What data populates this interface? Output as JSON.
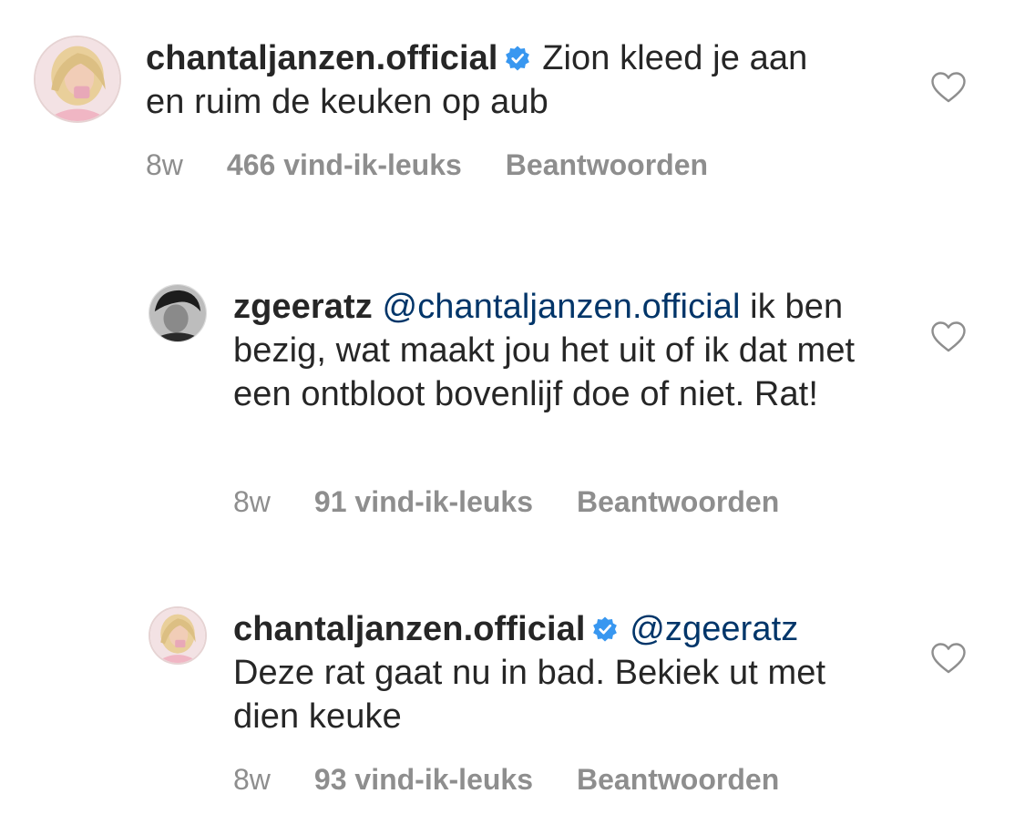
{
  "comments": [
    {
      "username": "chantaljanzen.official",
      "verified": true,
      "mention": "",
      "text": "Zion kleed je aan en ruim de keuken op aub",
      "time": "8w",
      "likes": "466 vind-ik-leuks",
      "reply": "Beantwoorden",
      "avatar_icon": "profile-photo-blonde-woman",
      "is_reply": false
    },
    {
      "username": "zgeeratz",
      "verified": false,
      "mention": "@chantaljanzen.official",
      "text": "ik ben bezig, wat maakt jou het uit of ik dat met een ontbloot bovenlijf doe of niet. Rat!",
      "time": "8w",
      "likes": "91 vind-ik-leuks",
      "reply": "Beantwoorden",
      "avatar_icon": "profile-photo-man-bw",
      "is_reply": true
    },
    {
      "username": "chantaljanzen.official",
      "verified": true,
      "mention": "@zgeeratz",
      "text": "Deze rat gaat nu in bad. Bekiek ut met dien keuke",
      "time": "8w",
      "likes": "93 vind-ik-leuks",
      "reply": "Beantwoorden",
      "avatar_icon": "profile-photo-blonde-woman",
      "is_reply": true
    }
  ],
  "colors": {
    "text": "#262626",
    "meta": "#8e8e8e",
    "mention": "#003569",
    "verified": "#3897f0",
    "heart_stroke": "#8e8e8e"
  },
  "icons": {
    "verified": "verified-badge-icon",
    "like": "heart-outline-icon"
  }
}
